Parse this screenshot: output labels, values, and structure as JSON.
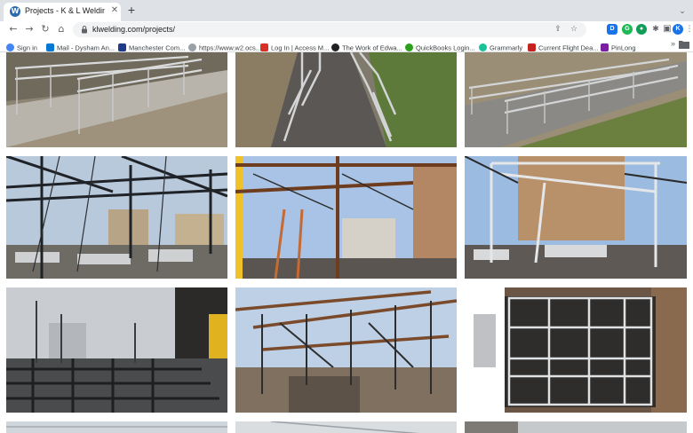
{
  "browser": {
    "tab": {
      "title": "Projects - K & L Welding",
      "favicon": "wordpress-icon"
    },
    "url": "klwelding.com/projects/",
    "profile_initial": "K",
    "extensions": [
      {
        "letter": "D",
        "color": "#1a73e8"
      },
      {
        "letter": "G",
        "color": "#1db954"
      },
      {
        "letter": "",
        "color": "#0f9d58"
      }
    ]
  },
  "bookmarks": [
    {
      "label": "Sign in",
      "icon": "google-icon",
      "color": "#4285f4"
    },
    {
      "label": "Mail - Dysham An...",
      "icon": "mail-icon",
      "color": "#0078d4"
    },
    {
      "label": "Manchester Com...",
      "icon": "bookmark-icon",
      "color": "#1e3a8a"
    },
    {
      "label": "https://www.w2.ocs...",
      "icon": "globe-icon",
      "color": "#5f6368"
    },
    {
      "label": "Log In | Access M...",
      "icon": "bookmark-icon",
      "color": "#d93025"
    },
    {
      "label": "The Work of Edwa...",
      "icon": "bookmark-icon",
      "color": "#202124"
    },
    {
      "label": "QuickBooks Login...",
      "icon": "bookmark-icon",
      "color": "#2ca01c"
    },
    {
      "label": "Grammarly",
      "icon": "bookmark-icon",
      "color": "#15c39a"
    },
    {
      "label": "Current Flight Dea...",
      "icon": "bookmark-icon",
      "color": "#c5221f"
    },
    {
      "label": "PinLong",
      "icon": "bookmark-icon",
      "color": "#7b1fa2"
    }
  ],
  "gallery": {
    "photos": [
      {
        "subject": "handrail-ramp-1"
      },
      {
        "subject": "handrail-ramp-2"
      },
      {
        "subject": "handrail-ramp-3"
      },
      {
        "subject": "steel-frame-1"
      },
      {
        "subject": "steel-frame-2"
      },
      {
        "subject": "steel-frame-3"
      },
      {
        "subject": "roof-deck-grid"
      },
      {
        "subject": "steel-frame-4"
      },
      {
        "subject": "window-frame"
      }
    ]
  }
}
